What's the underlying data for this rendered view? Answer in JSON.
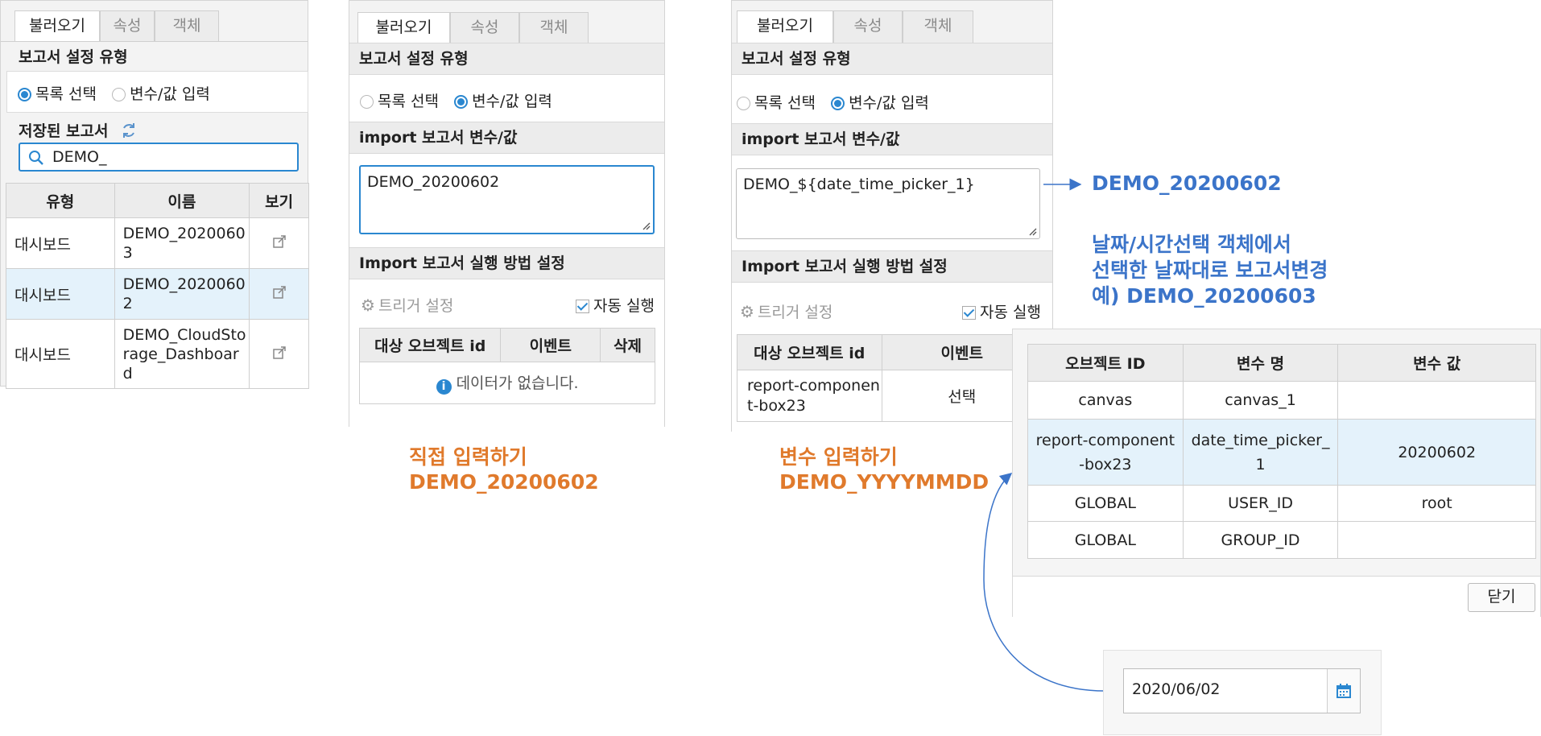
{
  "panel1": {
    "tabs": [
      "불러오기",
      "속성",
      "객체"
    ],
    "report_type_title": "보고서 설정 유형",
    "radio_list": "목록 선택",
    "radio_var": "변수/값 입력",
    "saved_title": "저장된 보고서",
    "search_value": "DEMO_",
    "columns": [
      "유형",
      "이름",
      "보기"
    ],
    "rows": [
      {
        "type": "대시보드",
        "name": "DEMO_20200603"
      },
      {
        "type": "대시보드",
        "name": "DEMO_20200602"
      },
      {
        "type": "대시보드",
        "name": "DEMO_CloudStorage_Dashboard"
      }
    ]
  },
  "panel2": {
    "tabs": [
      "불러오기",
      "속성",
      "객체"
    ],
    "report_type_title": "보고서 설정 유형",
    "radio_list": "목록 선택",
    "radio_var": "변수/값 입력",
    "import_title": "import 보고서 변수/값",
    "import_value": "DEMO_20200602",
    "exec_title": "Import 보고서 실행 방법 설정",
    "trigger_label": "트리거 설정",
    "auto_label": "자동 실행",
    "columns": [
      "대상 오브젝트 id",
      "이벤트",
      "삭제"
    ],
    "empty_text": "데이터가 없습니다."
  },
  "panel3": {
    "tabs": [
      "불러오기",
      "속성",
      "객체"
    ],
    "report_type_title": "보고서 설정 유형",
    "radio_list": "목록 선택",
    "radio_var": "변수/값 입력",
    "import_title": "import 보고서 변수/값",
    "import_value": "DEMO_${date_time_picker_1}",
    "exec_title": "Import 보고서 실행 방법 설정",
    "trigger_label": "트리거 설정",
    "auto_label": "자동 실행",
    "columns": [
      "대상 오브젝트 id",
      "이벤트"
    ],
    "row": {
      "object_id": "report-component-box23",
      "event": "선택"
    }
  },
  "annotations": {
    "direct_line1": "직접 입력하기",
    "direct_line2": "DEMO_20200602",
    "var_line1": "변수 입력하기",
    "var_line2": "DEMO_YYYYMMDD",
    "result_value": "DEMO_20200602",
    "desc_line1": "날짜/시간선택 객체에서",
    "desc_line2": "선택한 날짜대로 보고서변경",
    "desc_line3": "예) DEMO_20200603"
  },
  "variables_dialog": {
    "columns": [
      "오브젝트 ID",
      "변수 명",
      "변수 값"
    ],
    "rows": [
      {
        "object_id": "canvas",
        "var_name": "canvas_1",
        "value": ""
      },
      {
        "object_id": "report-component-box23",
        "var_name": "date_time_picker_1",
        "value": "20200602"
      },
      {
        "object_id": "GLOBAL",
        "var_name": "USER_ID",
        "value": "root"
      },
      {
        "object_id": "GLOBAL",
        "var_name": "GROUP_ID",
        "value": ""
      }
    ],
    "close_label": "닫기"
  },
  "date_picker": {
    "value": "2020/06/02",
    "icon": "calendar-icon"
  },
  "colors": {
    "accent": "#2a87d0",
    "annotation_orange": "#e07a2c",
    "annotation_blue": "#3b74c9",
    "selected_row": "#e4f2fb"
  }
}
